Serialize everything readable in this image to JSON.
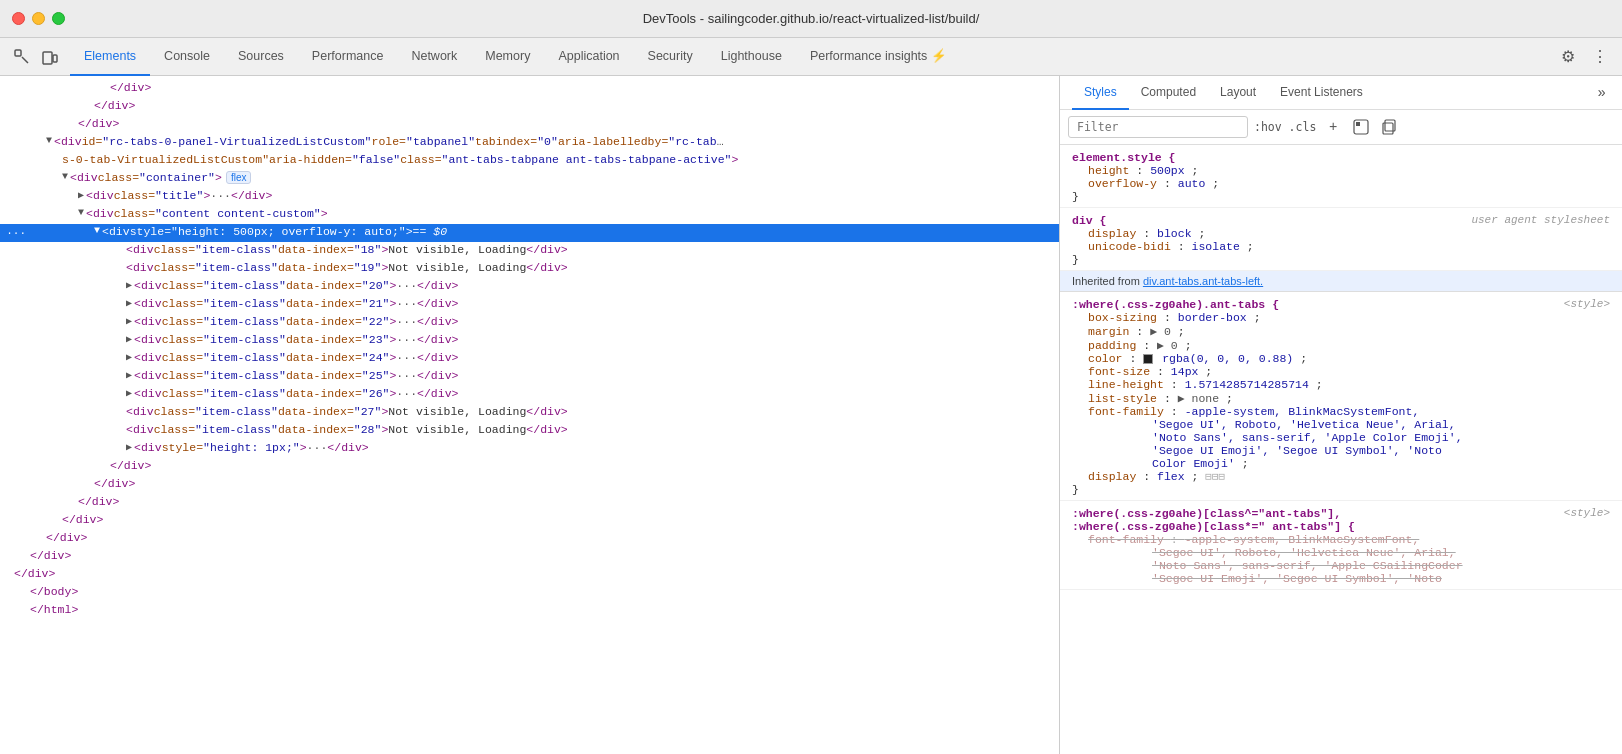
{
  "titleBar": {
    "title": "DevTools - sailingcoder.github.io/react-virtualized-list/build/"
  },
  "tabs": {
    "items": [
      {
        "id": "elements",
        "label": "Elements",
        "active": true
      },
      {
        "id": "console",
        "label": "Console",
        "active": false
      },
      {
        "id": "sources",
        "label": "Sources",
        "active": false
      },
      {
        "id": "performance",
        "label": "Performance",
        "active": false
      },
      {
        "id": "network",
        "label": "Network",
        "active": false
      },
      {
        "id": "memory",
        "label": "Memory",
        "active": false
      },
      {
        "id": "application",
        "label": "Application",
        "active": false
      },
      {
        "id": "security",
        "label": "Security",
        "active": false
      },
      {
        "id": "lighthouse",
        "label": "Lighthouse",
        "active": false
      },
      {
        "id": "performance-insights",
        "label": "Performance insights ⚡",
        "active": false
      }
    ]
  },
  "stylesTabs": {
    "items": [
      {
        "id": "styles",
        "label": "Styles",
        "active": true
      },
      {
        "id": "computed",
        "label": "Computed",
        "active": false
      },
      {
        "id": "layout",
        "label": "Layout",
        "active": false
      },
      {
        "id": "event-listeners",
        "label": "Event Listeners",
        "active": false
      }
    ]
  },
  "filterBar": {
    "placeholder": "Filter",
    "pseudoLabel": ":hov .cls",
    "icons": [
      "+",
      "⊞",
      "⊟"
    ]
  },
  "cssRules": [
    {
      "id": "element-style",
      "selector": "element.style {",
      "source": "",
      "properties": [
        {
          "name": "height",
          "value": "500px",
          "strikethrough": false
        },
        {
          "name": "overflow-y",
          "value": "auto",
          "strikethrough": false
        }
      ]
    },
    {
      "id": "div-user-agent",
      "selector": "div {",
      "source": "user agent stylesheet",
      "properties": [
        {
          "name": "display",
          "value": "block",
          "strikethrough": false
        },
        {
          "name": "unicode-bidi",
          "value": "isolate",
          "strikethrough": false
        }
      ]
    },
    {
      "id": "inherited-label",
      "label": "Inherited from div.ant-tabs.ant-tabs-left."
    },
    {
      "id": "where-css-zg0ahe-ant-tabs",
      "selector": ":where(.css-zg0ahe).ant-tabs {",
      "source": "<style>",
      "properties": [
        {
          "name": "box-sizing",
          "value": "border-box",
          "strikethrough": false
        },
        {
          "name": "margin",
          "value": "▶ 0",
          "strikethrough": false
        },
        {
          "name": "padding",
          "value": "▶ 0",
          "strikethrough": false
        },
        {
          "name": "color",
          "value": "rgba(0, 0, 0, 0.88)",
          "strikethrough": false,
          "hasSwatch": true
        },
        {
          "name": "font-size",
          "value": "14px",
          "strikethrough": false
        },
        {
          "name": "line-height",
          "value": "1.5714285714285714",
          "strikethrough": false
        },
        {
          "name": "list-style",
          "value": "▶ none",
          "strikethrough": false
        },
        {
          "name": "font-family",
          "value": "-apple-system, BlinkMacSystemFont, 'Segoe UI', Roboto, 'Helvetica Neue', Arial, 'Noto Sans', sans-serif, 'Apple Color Emoji', 'Segoe UI Emoji', 'Segoe UI Symbol', 'Noto Color Emoji'",
          "strikethrough": false
        },
        {
          "name": "display",
          "value": "flex",
          "strikethrough": false,
          "hasBadge": "|||"
        }
      ]
    },
    {
      "id": "where-css-zg0ahe-ant-tabs-2",
      "selector": ":where(.css-zg0ahe)[class^=\"ant-tabs\"],\n:where(.css-zg0ahe)[class*=\" ant-tabs\"] {",
      "source": "<style>",
      "properties": [
        {
          "name": "font-family",
          "value": "-apple-system, BlinkMacSystemFont, 'Segoe UI', Roboto, 'Helvetica Neue', Arial, 'Noto Sans', sans-serif, 'Apple Color Emoji', 'Segoe UI Emoji', 'Segoe UI Symbol', 'Noto",
          "strikethrough": true
        }
      ]
    }
  ],
  "domLines": [
    {
      "indent": 4,
      "content": "</div>",
      "type": "closing"
    },
    {
      "indent": 3,
      "content": "</div>",
      "type": "closing"
    },
    {
      "indent": 2,
      "content": "</div>",
      "type": "closing"
    },
    {
      "indent": 1,
      "hasExpand": true,
      "expandOpen": true,
      "content": "<div id=\"rc-tabs-0-panel-VirtualizedListCustom\" role=\"tabpanel\" tabindex=\"0\" aria-labelledby=\"rc-tab s-0-tab-VirtualizedListCustom\" aria-hidden=\"false\" class=\"ant-tabs-tabpane ant-tabs-tabpane-active\">",
      "type": "open",
      "truncated": true
    },
    {
      "indent": 2,
      "hasExpand": true,
      "expandOpen": true,
      "content": "<div class=\"container\">",
      "type": "open",
      "badge": "flex"
    },
    {
      "indent": 3,
      "hasExpand": false,
      "content": "<div class=\"title\"> ··· </div>",
      "type": "self"
    },
    {
      "indent": 3,
      "hasExpand": true,
      "expandOpen": true,
      "content": "<div class=\"content content-custom\">",
      "type": "open"
    },
    {
      "indent": 4,
      "hasExpand": true,
      "expandOpen": true,
      "content": "<div style=\"height: 500px; overflow-y: auto;\"> == $0",
      "type": "open",
      "selected": true,
      "ellipsis": "..."
    },
    {
      "indent": 5,
      "content": "<div class=\"item-class\" data-index=\"18\">Not visible, Loading</div>",
      "type": "self"
    },
    {
      "indent": 5,
      "content": "<div class=\"item-class\" data-index=\"19\">Not visible, Loading</div>",
      "type": "self"
    },
    {
      "indent": 5,
      "hasExpand": true,
      "content": "<div class=\"item-class\" data-index=\"20\"> ··· </div>",
      "type": "self"
    },
    {
      "indent": 5,
      "hasExpand": true,
      "content": "<div class=\"item-class\" data-index=\"21\"> ··· </div>",
      "type": "self"
    },
    {
      "indent": 5,
      "hasExpand": true,
      "content": "<div class=\"item-class\" data-index=\"22\"> ··· </div>",
      "type": "self"
    },
    {
      "indent": 5,
      "hasExpand": true,
      "content": "<div class=\"item-class\" data-index=\"23\"> ··· </div>",
      "type": "self"
    },
    {
      "indent": 5,
      "hasExpand": true,
      "content": "<div class=\"item-class\" data-index=\"24\"> ··· </div>",
      "type": "self"
    },
    {
      "indent": 5,
      "hasExpand": true,
      "content": "<div class=\"item-class\" data-index=\"25\"> ··· </div>",
      "type": "self"
    },
    {
      "indent": 5,
      "hasExpand": true,
      "content": "<div class=\"item-class\" data-index=\"26\"> ··· </div>",
      "type": "self"
    },
    {
      "indent": 5,
      "content": "<div class=\"item-class\" data-index=\"27\">Not visible, Loading</div>",
      "type": "self"
    },
    {
      "indent": 5,
      "content": "<div class=\"item-class\" data-index=\"28\">Not visible, Loading</div>",
      "type": "self"
    },
    {
      "indent": 5,
      "hasExpand": true,
      "content": "<div style=\"height: 1px;\"> ··· </div>",
      "type": "self"
    },
    {
      "indent": 4,
      "content": "</div>",
      "type": "closing"
    },
    {
      "indent": 3,
      "content": "</div>",
      "type": "closing"
    },
    {
      "indent": 2,
      "content": "</div>",
      "type": "closing"
    },
    {
      "indent": 1,
      "content": "</div>",
      "type": "closing"
    },
    {
      "indent": 0,
      "content": "</div>",
      "type": "closing"
    },
    {
      "indent": -1,
      "content": "</div>",
      "type": "closing"
    },
    {
      "indent": -2,
      "content": "</div>",
      "type": "closing"
    },
    {
      "indent": -3,
      "content": "</body>",
      "type": "closing"
    },
    {
      "indent": -4,
      "content": "</html>",
      "type": "closing"
    }
  ]
}
